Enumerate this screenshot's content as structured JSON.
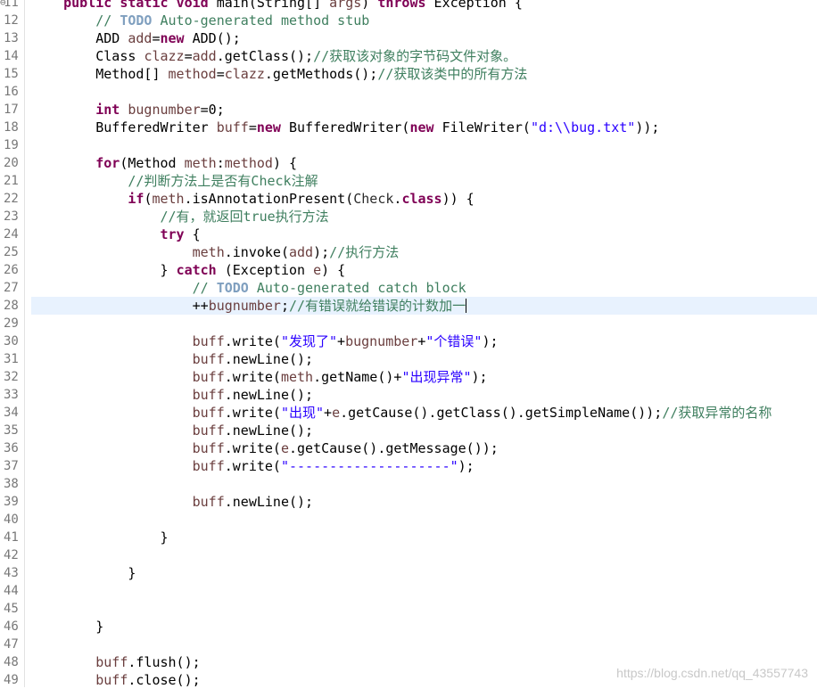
{
  "editor": {
    "lines": [
      {
        "n": "11",
        "fold": "⊖",
        "tokens": [
          {
            "t": "    "
          },
          {
            "t": "public",
            "c": "kw"
          },
          {
            "t": " "
          },
          {
            "t": "static",
            "c": "kw"
          },
          {
            "t": " "
          },
          {
            "t": "void",
            "c": "kw"
          },
          {
            "t": " main(String[] "
          },
          {
            "t": "args",
            "c": "var"
          },
          {
            "t": ") "
          },
          {
            "t": "throws",
            "c": "kw"
          },
          {
            "t": " Exception {"
          }
        ]
      },
      {
        "n": "12",
        "tokens": [
          {
            "t": "        "
          },
          {
            "t": "// ",
            "c": "cm"
          },
          {
            "t": "TODO",
            "c": "tag"
          },
          {
            "t": " Auto-generated method stub",
            "c": "cm"
          }
        ]
      },
      {
        "n": "13",
        "tokens": [
          {
            "t": "        ADD "
          },
          {
            "t": "add",
            "c": "var"
          },
          {
            "t": "="
          },
          {
            "t": "new",
            "c": "kw"
          },
          {
            "t": " ADD();"
          }
        ]
      },
      {
        "n": "14",
        "tokens": [
          {
            "t": "        Class "
          },
          {
            "t": "clazz",
            "c": "var"
          },
          {
            "t": "="
          },
          {
            "t": "add",
            "c": "var"
          },
          {
            "t": ".getClass();"
          },
          {
            "t": "//获取该对象的字节码文件对象。",
            "c": "cm"
          }
        ]
      },
      {
        "n": "15",
        "tokens": [
          {
            "t": "        Method[] "
          },
          {
            "t": "method",
            "c": "var"
          },
          {
            "t": "="
          },
          {
            "t": "clazz",
            "c": "var"
          },
          {
            "t": ".getMethods();"
          },
          {
            "t": "//获取该类中的所有方法",
            "c": "cm"
          }
        ]
      },
      {
        "n": "16",
        "tokens": []
      },
      {
        "n": "17",
        "tokens": [
          {
            "t": "        "
          },
          {
            "t": "int",
            "c": "kw"
          },
          {
            "t": " "
          },
          {
            "t": "bugnumber",
            "c": "var"
          },
          {
            "t": "=0;"
          }
        ]
      },
      {
        "n": "18",
        "tokens": [
          {
            "t": "        BufferedWriter "
          },
          {
            "t": "buff",
            "c": "var"
          },
          {
            "t": "="
          },
          {
            "t": "new",
            "c": "kw"
          },
          {
            "t": " BufferedWriter("
          },
          {
            "t": "new",
            "c": "kw"
          },
          {
            "t": " FileWriter("
          },
          {
            "t": "\"d:\\\\bug.txt\"",
            "c": "str"
          },
          {
            "t": "));"
          }
        ]
      },
      {
        "n": "19",
        "tokens": []
      },
      {
        "n": "20",
        "tokens": [
          {
            "t": "        "
          },
          {
            "t": "for",
            "c": "kw"
          },
          {
            "t": "(Method "
          },
          {
            "t": "meth",
            "c": "var"
          },
          {
            "t": ":"
          },
          {
            "t": "method",
            "c": "var"
          },
          {
            "t": ") {"
          }
        ]
      },
      {
        "n": "21",
        "tokens": [
          {
            "t": "            "
          },
          {
            "t": "//判断方法上是否有Check注解",
            "c": "cm"
          }
        ]
      },
      {
        "n": "22",
        "tokens": [
          {
            "t": "            "
          },
          {
            "t": "if",
            "c": "kw"
          },
          {
            "t": "("
          },
          {
            "t": "meth",
            "c": "var"
          },
          {
            "t": ".isAnnotationPresent("
          },
          {
            "t": "Check",
            "c": "sty"
          },
          {
            "t": "."
          },
          {
            "t": "class",
            "c": "kw"
          },
          {
            "t": ")) {"
          }
        ]
      },
      {
        "n": "23",
        "tokens": [
          {
            "t": "                "
          },
          {
            "t": "//有，就返回true执行方法",
            "c": "cm"
          }
        ]
      },
      {
        "n": "24",
        "tokens": [
          {
            "t": "                "
          },
          {
            "t": "try",
            "c": "kw"
          },
          {
            "t": " {"
          }
        ]
      },
      {
        "n": "25",
        "tokens": [
          {
            "t": "                    "
          },
          {
            "t": "meth",
            "c": "var"
          },
          {
            "t": ".invoke("
          },
          {
            "t": "add",
            "c": "var"
          },
          {
            "t": ");"
          },
          {
            "t": "//执行方法",
            "c": "cm"
          }
        ]
      },
      {
        "n": "26",
        "tokens": [
          {
            "t": "                } "
          },
          {
            "t": "catch",
            "c": "kw"
          },
          {
            "t": " (Exception "
          },
          {
            "t": "e",
            "c": "var"
          },
          {
            "t": ") {"
          }
        ]
      },
      {
        "n": "27",
        "tokens": [
          {
            "t": "                    "
          },
          {
            "t": "// ",
            "c": "cm"
          },
          {
            "t": "TODO",
            "c": "tag"
          },
          {
            "t": " Auto-generated catch block",
            "c": "cm"
          }
        ]
      },
      {
        "n": "28",
        "current": true,
        "cursor": true,
        "tokens": [
          {
            "t": "                    ++"
          },
          {
            "t": "bugnumber",
            "c": "var"
          },
          {
            "t": ";"
          },
          {
            "t": "//有错误就给错误的计数加一",
            "c": "cm"
          }
        ]
      },
      {
        "n": "29",
        "tokens": []
      },
      {
        "n": "30",
        "tokens": [
          {
            "t": "                    "
          },
          {
            "t": "buff",
            "c": "var"
          },
          {
            "t": ".write("
          },
          {
            "t": "\"发现了\"",
            "c": "str"
          },
          {
            "t": "+"
          },
          {
            "t": "bugnumber",
            "c": "var"
          },
          {
            "t": "+"
          },
          {
            "t": "\"个错误\"",
            "c": "str"
          },
          {
            "t": ");"
          }
        ]
      },
      {
        "n": "31",
        "tokens": [
          {
            "t": "                    "
          },
          {
            "t": "buff",
            "c": "var"
          },
          {
            "t": ".newLine();"
          }
        ]
      },
      {
        "n": "32",
        "tokens": [
          {
            "t": "                    "
          },
          {
            "t": "buff",
            "c": "var"
          },
          {
            "t": ".write("
          },
          {
            "t": "meth",
            "c": "var"
          },
          {
            "t": ".getName()+"
          },
          {
            "t": "\"出现异常\"",
            "c": "str"
          },
          {
            "t": ");"
          }
        ]
      },
      {
        "n": "33",
        "tokens": [
          {
            "t": "                    "
          },
          {
            "t": "buff",
            "c": "var"
          },
          {
            "t": ".newLine();"
          }
        ]
      },
      {
        "n": "34",
        "tokens": [
          {
            "t": "                    "
          },
          {
            "t": "buff",
            "c": "var"
          },
          {
            "t": ".write("
          },
          {
            "t": "\"出现\"",
            "c": "str"
          },
          {
            "t": "+"
          },
          {
            "t": "e",
            "c": "var"
          },
          {
            "t": ".getCause().getClass().getSimpleName());"
          },
          {
            "t": "//获取异常的名称",
            "c": "cm"
          }
        ]
      },
      {
        "n": "35",
        "tokens": [
          {
            "t": "                    "
          },
          {
            "t": "buff",
            "c": "var"
          },
          {
            "t": ".newLine();"
          }
        ]
      },
      {
        "n": "36",
        "tokens": [
          {
            "t": "                    "
          },
          {
            "t": "buff",
            "c": "var"
          },
          {
            "t": ".write("
          },
          {
            "t": "e",
            "c": "var"
          },
          {
            "t": ".getCause().getMessage());"
          }
        ]
      },
      {
        "n": "37",
        "tokens": [
          {
            "t": "                    "
          },
          {
            "t": "buff",
            "c": "var"
          },
          {
            "t": ".write("
          },
          {
            "t": "\"--------------------\"",
            "c": "str"
          },
          {
            "t": ");"
          }
        ]
      },
      {
        "n": "38",
        "tokens": []
      },
      {
        "n": "39",
        "tokens": [
          {
            "t": "                    "
          },
          {
            "t": "buff",
            "c": "var"
          },
          {
            "t": ".newLine();"
          }
        ]
      },
      {
        "n": "40",
        "tokens": []
      },
      {
        "n": "41",
        "tokens": [
          {
            "t": "                }"
          }
        ]
      },
      {
        "n": "42",
        "tokens": []
      },
      {
        "n": "43",
        "tokens": [
          {
            "t": "            }"
          }
        ]
      },
      {
        "n": "44",
        "tokens": []
      },
      {
        "n": "45",
        "tokens": []
      },
      {
        "n": "46",
        "tokens": [
          {
            "t": "        }"
          }
        ]
      },
      {
        "n": "47",
        "tokens": []
      },
      {
        "n": "48",
        "tokens": [
          {
            "t": "        "
          },
          {
            "t": "buff",
            "c": "var"
          },
          {
            "t": ".flush();"
          }
        ]
      },
      {
        "n": "49",
        "tokens": [
          {
            "t": "        "
          },
          {
            "t": "buff",
            "c": "var"
          },
          {
            "t": ".close();"
          }
        ]
      }
    ]
  },
  "watermark": "https://blog.csdn.net/qq_43557743"
}
